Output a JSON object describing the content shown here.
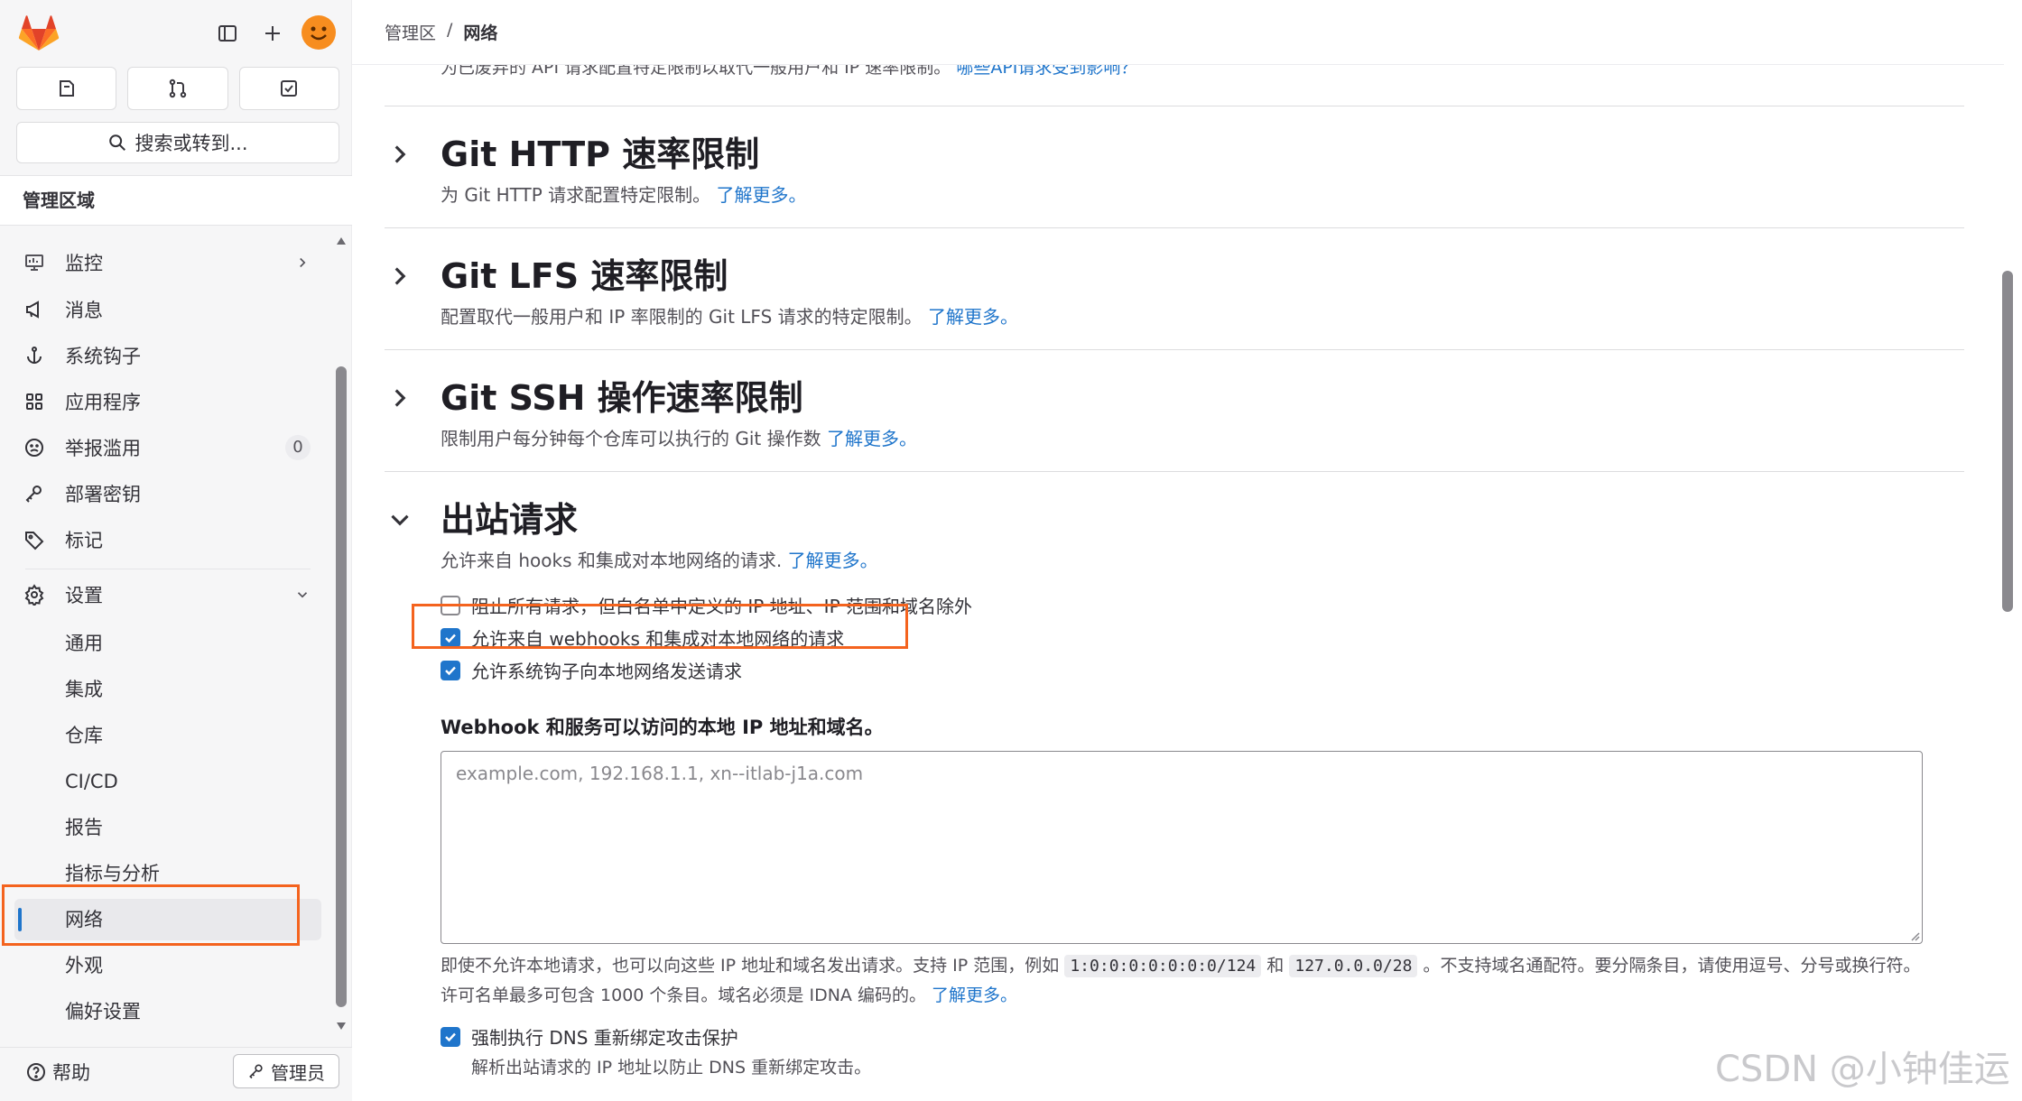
{
  "sidebar": {
    "search_label": "搜索或转到...",
    "section_title": "管理区域",
    "items": [
      {
        "label": "监控",
        "icon": "monitor-icon"
      },
      {
        "label": "消息",
        "icon": "megaphone-icon"
      },
      {
        "label": "系统钩子",
        "icon": "anchor-icon"
      },
      {
        "label": "应用程序",
        "icon": "grid-icon"
      },
      {
        "label": "举报滥用",
        "icon": "sad-face-icon",
        "badge": "0"
      },
      {
        "label": "部署密钥",
        "icon": "key-icon"
      },
      {
        "label": "标记",
        "icon": "label-icon"
      }
    ],
    "settings": {
      "label": "设置",
      "icon": "gear-icon"
    },
    "settings_items": [
      "通用",
      "集成",
      "仓库",
      "CI/CD",
      "报告",
      "指标与分析",
      "网络",
      "外观",
      "偏好设置"
    ],
    "active_item": "网络",
    "help_label": "帮助",
    "admin_label": "管理员"
  },
  "breadcrumb": {
    "parent": "管理区",
    "separator": "/",
    "current": "网络"
  },
  "cut_line": {
    "text": "为已废弃的 API 请求配置特定限制以取代一般用户和 IP 速率限制。",
    "link": "哪些API请求受到影响？"
  },
  "sections": [
    {
      "title": "Git HTTP 速率限制",
      "desc": "为 Git HTTP 请求配置特定限制。",
      "link": "了解更多。",
      "expanded": false
    },
    {
      "title": "Git LFS 速率限制",
      "desc": "配置取代一般用户和 IP 率限制的 Git LFS 请求的特定限制。",
      "link": "了解更多。",
      "expanded": false
    },
    {
      "title": "Git SSH 操作速率限制",
      "desc": "限制用户每分钟每个仓库可以执行的 Git 操作数",
      "link": "了解更多。",
      "expanded": false
    },
    {
      "title": "出站请求",
      "desc": "允许来自 hooks 和集成对本地网络的请求.",
      "link": "了解更多。",
      "expanded": true
    }
  ],
  "outbound": {
    "checkboxes": [
      {
        "label": "阻止所有请求，但白名单中定义的 IP 地址、IP 范围和域名除外",
        "checked": false
      },
      {
        "label": "允许来自 webhooks 和集成对本地网络的请求",
        "checked": true
      },
      {
        "label": "允许系统钩子向本地网络发送请求",
        "checked": true
      }
    ],
    "allowlist_label": "Webhook 和服务可以访问的本地 IP 地址和域名。",
    "allowlist_placeholder": "example.com, 192.168.1.1, xn--itlab-j1a.com",
    "help_part1": "即使不允许本地请求，也可以向这些 IP 地址和域名发出请求。支持 IP 范围，例如",
    "help_code1": "1:0:0:0:0:0:0:0/124",
    "help_and": "和",
    "help_code2": "127.0.0.0/28",
    "help_part2": "。不支持域名通配符。要分隔条目，请使用逗号、分号或换行符。许可名单最多可包含 1000 个条目。域名必须是 IDNA 编码的。",
    "help_link": "了解更多。",
    "dns_label": "强制执行 DNS 重新绑定攻击保护",
    "dns_checked": true,
    "dns_hint": "解析出站请求的 IP 地址以防止 DNS 重新绑定攻击。"
  },
  "watermark": "CSDN @小钟佳运",
  "colors": {
    "accent": "#1f75cb",
    "highlight": "#f4631e",
    "brand": "#fc6d26"
  }
}
